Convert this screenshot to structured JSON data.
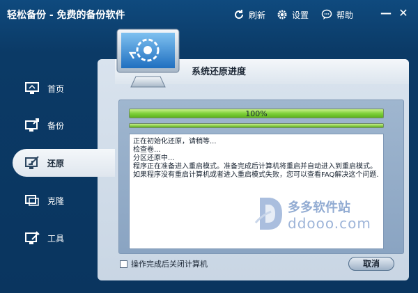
{
  "window": {
    "title": "轻松备份 - 免费的备份软件",
    "refresh_label": "刷新",
    "settings_label": "设置",
    "help_label": "帮助",
    "minimize_label": "—",
    "close_label": "✕"
  },
  "sidebar": {
    "items": [
      {
        "label": "首页",
        "icon": "home-monitor-icon"
      },
      {
        "label": "备份",
        "icon": "backup-icon"
      },
      {
        "label": "还原",
        "icon": "restore-icon",
        "active": true
      },
      {
        "label": "克隆",
        "icon": "clone-icon"
      },
      {
        "label": "工具",
        "icon": "tools-icon"
      }
    ]
  },
  "main": {
    "title": "系统还原进度",
    "progress": {
      "value": 100,
      "label": "100%"
    },
    "log_lines": [
      "正在初始化还原，请稍等...",
      "检查卷...",
      "分区还原中...",
      "程序正在准备进入重启模式。准备完成后计算机将重启并自动进入到重启模式。如果程序没有重启计算机或者进入重启模式失败，您可以查看FAQ解决这个问题."
    ],
    "shutdown_checkbox_label": "操作完成后关闭计算机",
    "cancel_label": "取消"
  },
  "watermark": {
    "text1": "多多软件站",
    "text2": "ddooo.com"
  },
  "colors": {
    "accent": "#0b3a66",
    "progress": "#7fd13a",
    "panel": "#d9e3ee"
  }
}
